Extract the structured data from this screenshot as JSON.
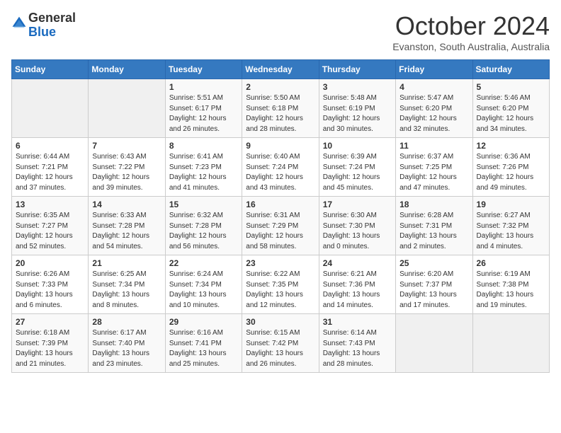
{
  "header": {
    "logo_general": "General",
    "logo_blue": "Blue",
    "month_title": "October 2024",
    "location": "Evanston, South Australia, Australia"
  },
  "days_of_week": [
    "Sunday",
    "Monday",
    "Tuesday",
    "Wednesday",
    "Thursday",
    "Friday",
    "Saturday"
  ],
  "weeks": [
    [
      {
        "day": null,
        "info": null
      },
      {
        "day": null,
        "info": null
      },
      {
        "day": "1",
        "info": "Sunrise: 5:51 AM\nSunset: 6:17 PM\nDaylight: 12 hours and 26 minutes."
      },
      {
        "day": "2",
        "info": "Sunrise: 5:50 AM\nSunset: 6:18 PM\nDaylight: 12 hours and 28 minutes."
      },
      {
        "day": "3",
        "info": "Sunrise: 5:48 AM\nSunset: 6:19 PM\nDaylight: 12 hours and 30 minutes."
      },
      {
        "day": "4",
        "info": "Sunrise: 5:47 AM\nSunset: 6:20 PM\nDaylight: 12 hours and 32 minutes."
      },
      {
        "day": "5",
        "info": "Sunrise: 5:46 AM\nSunset: 6:20 PM\nDaylight: 12 hours and 34 minutes."
      }
    ],
    [
      {
        "day": "6",
        "info": "Sunrise: 6:44 AM\nSunset: 7:21 PM\nDaylight: 12 hours and 37 minutes."
      },
      {
        "day": "7",
        "info": "Sunrise: 6:43 AM\nSunset: 7:22 PM\nDaylight: 12 hours and 39 minutes."
      },
      {
        "day": "8",
        "info": "Sunrise: 6:41 AM\nSunset: 7:23 PM\nDaylight: 12 hours and 41 minutes."
      },
      {
        "day": "9",
        "info": "Sunrise: 6:40 AM\nSunset: 7:24 PM\nDaylight: 12 hours and 43 minutes."
      },
      {
        "day": "10",
        "info": "Sunrise: 6:39 AM\nSunset: 7:24 PM\nDaylight: 12 hours and 45 minutes."
      },
      {
        "day": "11",
        "info": "Sunrise: 6:37 AM\nSunset: 7:25 PM\nDaylight: 12 hours and 47 minutes."
      },
      {
        "day": "12",
        "info": "Sunrise: 6:36 AM\nSunset: 7:26 PM\nDaylight: 12 hours and 49 minutes."
      }
    ],
    [
      {
        "day": "13",
        "info": "Sunrise: 6:35 AM\nSunset: 7:27 PM\nDaylight: 12 hours and 52 minutes."
      },
      {
        "day": "14",
        "info": "Sunrise: 6:33 AM\nSunset: 7:28 PM\nDaylight: 12 hours and 54 minutes."
      },
      {
        "day": "15",
        "info": "Sunrise: 6:32 AM\nSunset: 7:28 PM\nDaylight: 12 hours and 56 minutes."
      },
      {
        "day": "16",
        "info": "Sunrise: 6:31 AM\nSunset: 7:29 PM\nDaylight: 12 hours and 58 minutes."
      },
      {
        "day": "17",
        "info": "Sunrise: 6:30 AM\nSunset: 7:30 PM\nDaylight: 13 hours and 0 minutes."
      },
      {
        "day": "18",
        "info": "Sunrise: 6:28 AM\nSunset: 7:31 PM\nDaylight: 13 hours and 2 minutes."
      },
      {
        "day": "19",
        "info": "Sunrise: 6:27 AM\nSunset: 7:32 PM\nDaylight: 13 hours and 4 minutes."
      }
    ],
    [
      {
        "day": "20",
        "info": "Sunrise: 6:26 AM\nSunset: 7:33 PM\nDaylight: 13 hours and 6 minutes."
      },
      {
        "day": "21",
        "info": "Sunrise: 6:25 AM\nSunset: 7:34 PM\nDaylight: 13 hours and 8 minutes."
      },
      {
        "day": "22",
        "info": "Sunrise: 6:24 AM\nSunset: 7:34 PM\nDaylight: 13 hours and 10 minutes."
      },
      {
        "day": "23",
        "info": "Sunrise: 6:22 AM\nSunset: 7:35 PM\nDaylight: 13 hours and 12 minutes."
      },
      {
        "day": "24",
        "info": "Sunrise: 6:21 AM\nSunset: 7:36 PM\nDaylight: 13 hours and 14 minutes."
      },
      {
        "day": "25",
        "info": "Sunrise: 6:20 AM\nSunset: 7:37 PM\nDaylight: 13 hours and 17 minutes."
      },
      {
        "day": "26",
        "info": "Sunrise: 6:19 AM\nSunset: 7:38 PM\nDaylight: 13 hours and 19 minutes."
      }
    ],
    [
      {
        "day": "27",
        "info": "Sunrise: 6:18 AM\nSunset: 7:39 PM\nDaylight: 13 hours and 21 minutes."
      },
      {
        "day": "28",
        "info": "Sunrise: 6:17 AM\nSunset: 7:40 PM\nDaylight: 13 hours and 23 minutes."
      },
      {
        "day": "29",
        "info": "Sunrise: 6:16 AM\nSunset: 7:41 PM\nDaylight: 13 hours and 25 minutes."
      },
      {
        "day": "30",
        "info": "Sunrise: 6:15 AM\nSunset: 7:42 PM\nDaylight: 13 hours and 26 minutes."
      },
      {
        "day": "31",
        "info": "Sunrise: 6:14 AM\nSunset: 7:43 PM\nDaylight: 13 hours and 28 minutes."
      },
      {
        "day": null,
        "info": null
      },
      {
        "day": null,
        "info": null
      }
    ]
  ]
}
